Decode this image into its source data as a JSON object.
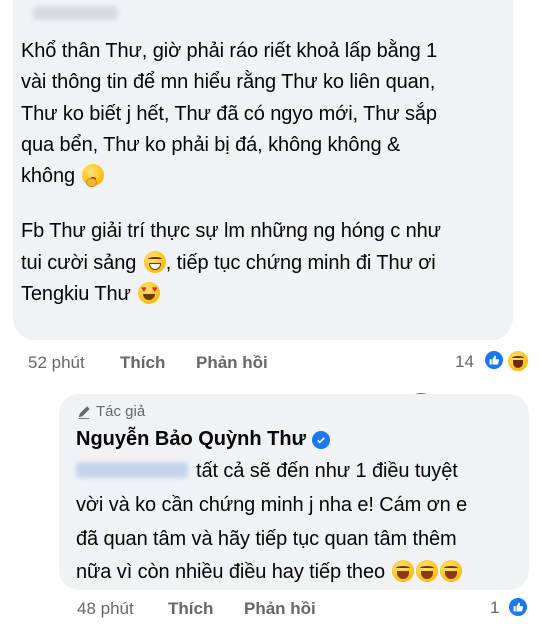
{
  "comment": {
    "author_blurred": true,
    "lines": [
      "Khổ thân Thư, giờ phải ráo riết khoả lấp bằng 1",
      "vài thông tin để mn hiểu rằng Thư ko liên quan,",
      "Thư ko biết j hết, Thư đã có ngyo mới, Thư sắp",
      "qua bển, Thư ko phải bị đá, không không &",
      "không"
    ],
    "lines2": [
      "Fb Thư giải trí thực sự lm những ng hóng c như",
      "tui cười sảng",
      ", tiếp tục chứng minh đi Thư ơi",
      "Tengkiu Thư"
    ],
    "time": "52 phút",
    "like_label": "Thích",
    "reply_label": "Phản hồi",
    "reaction_count": "14"
  },
  "reply": {
    "author_tag": "Tác giả",
    "author_name": "Nguyễn Bảo Quỳnh Thư",
    "text_line1": "tất cả sẽ đến như 1 điều tuyệt",
    "text_line2": "vời và ko cần chứng minh j nha e! Cám ơn e",
    "text_line3": "đã quan tâm và hãy tiếp tục quan tâm thêm",
    "text_line4": "nữa vì còn nhiều điều hay tiếp theo",
    "time": "48 phút",
    "like_label": "Thích",
    "reply_label": "Phản hồi",
    "reaction_count": "1"
  },
  "colors": {
    "bubble": "#f0f2f5",
    "meta_text": "#65676b",
    "like_blue": "#1877f2"
  },
  "icons": [
    "hush-emoji",
    "grin-emoji",
    "heart-eyes-emoji",
    "like-reaction-icon",
    "haha-reaction-icon",
    "pencil-icon",
    "verified-badge-icon",
    "squint-laugh-emoji"
  ]
}
